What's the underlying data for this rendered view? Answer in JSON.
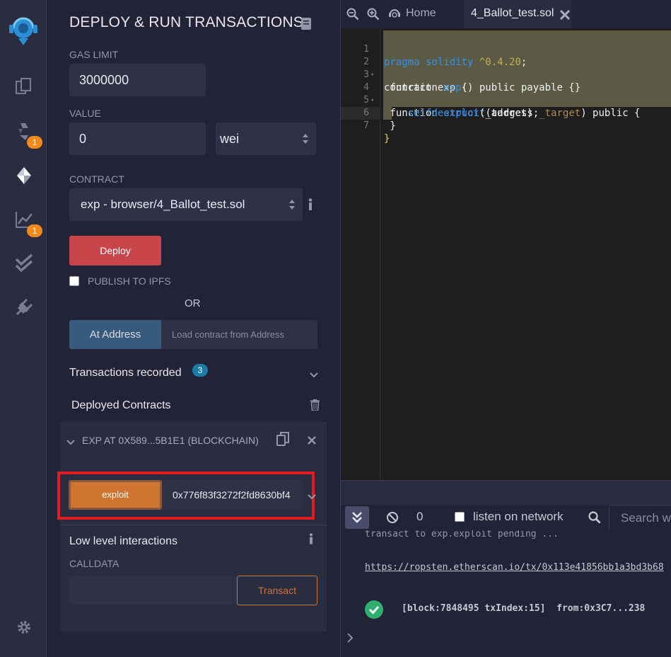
{
  "rail": {
    "badges": {
      "compiler": "1",
      "analysis": "1"
    }
  },
  "panel": {
    "title": "DEPLOY & RUN TRANSACTIONS",
    "gas_limit_label": "GAS LIMIT",
    "gas_limit_value": "3000000",
    "value_label": "VALUE",
    "value_amount": "0",
    "value_unit": "wei",
    "contract_label": "CONTRACT",
    "contract_selected": "exp - browser/4_Ballot_test.sol",
    "deploy_label": "Deploy",
    "publish_label": "PUBLISH TO IPFS",
    "or_label": "OR",
    "at_address_label": "At Address",
    "at_address_placeholder": "Load contract from Address",
    "transactions_recorded_label": "Transactions recorded",
    "transactions_recorded_count": "3",
    "deployed_contracts_label": "Deployed Contracts",
    "instance_name": "EXP AT 0X589...5B1E1 (BLOCKCHAIN)",
    "exploit_label": "exploit",
    "exploit_arg": "0x776f83f3272f2fd8630bf4",
    "low_level_label": "Low level interactions",
    "calldata_label": "CALLDATA",
    "transact_label": "Transact"
  },
  "tabs": {
    "home_label": "Home",
    "file_label": "4_Ballot_test.sol"
  },
  "editor": {
    "line_numbers": [
      "1",
      "2",
      "3",
      "4",
      "5",
      "6",
      "7"
    ]
  },
  "terminal": {
    "pending_count": "0",
    "listen_label": "listen on network",
    "search_placeholder": "Search w",
    "pending_line": "transact to exp.exploit pending ...",
    "link_line": "https://ropsten.etherscan.io/tx/0x113e41856bb1a3bd3b68",
    "block_line": "[block:7848495 txIndex:15]",
    "from_line": "from:0x3C7...238"
  },
  "colors": {
    "deploy": "#c8454a",
    "exploit": "#d07432",
    "highlight_box": "#e31b23",
    "badge_orange": "#f08a1c",
    "badge_blue": "#1a7da6"
  }
}
